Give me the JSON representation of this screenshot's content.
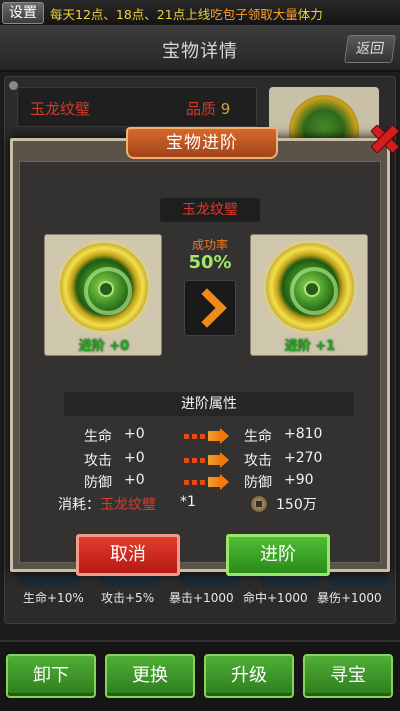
{
  "top_bar": {
    "settings_label": "设置",
    "notice": {
      "part1": "每天12点、18点、21点上线",
      "part2": "吃包子领取大量",
      "part3": "体力"
    }
  },
  "header": {
    "title": "宝物详情",
    "back_label": "返回"
  },
  "background_panel": {
    "item_name": "玉龙纹璧",
    "quality_label": "品质",
    "quality_value": "9",
    "stats": [
      "生命+10%",
      "攻击+5%",
      "暴击+1000",
      "命中+1000",
      "暴伤+1000"
    ]
  },
  "modal": {
    "title": "宝物进阶",
    "item_name": "玉龙纹璧",
    "success_rate_label": "成功率",
    "success_rate_value": "50%",
    "current_card_label": "进阶 +0",
    "next_card_label": "进阶 +1",
    "section_title": "进阶属性",
    "attributes": [
      {
        "name": "生命",
        "current": "+0",
        "next_name": "生命",
        "next": "+810"
      },
      {
        "name": "攻击",
        "current": "+0",
        "next_name": "攻击",
        "next": "+270"
      },
      {
        "name": "防御",
        "current": "+0",
        "next_name": "防御",
        "next": "+90"
      }
    ],
    "cost": {
      "label": "消耗：",
      "item": "玉龙纹璧",
      "quantity": "*1",
      "coin_amount": "150万"
    },
    "cancel_label": "取消",
    "advance_label": "进阶"
  },
  "bottom_bar": {
    "buttons": [
      "卸下",
      "更换",
      "升级",
      "寻宝"
    ]
  },
  "colors": {
    "accent_green": "#3e9a26",
    "accent_red": "#c82a1e",
    "title_orange": "#c2561f",
    "item_name_red": "#e0392a"
  },
  "icons": [
    "close-icon",
    "arrow-right-icon",
    "coin-icon",
    "jade-disc-icon"
  ]
}
